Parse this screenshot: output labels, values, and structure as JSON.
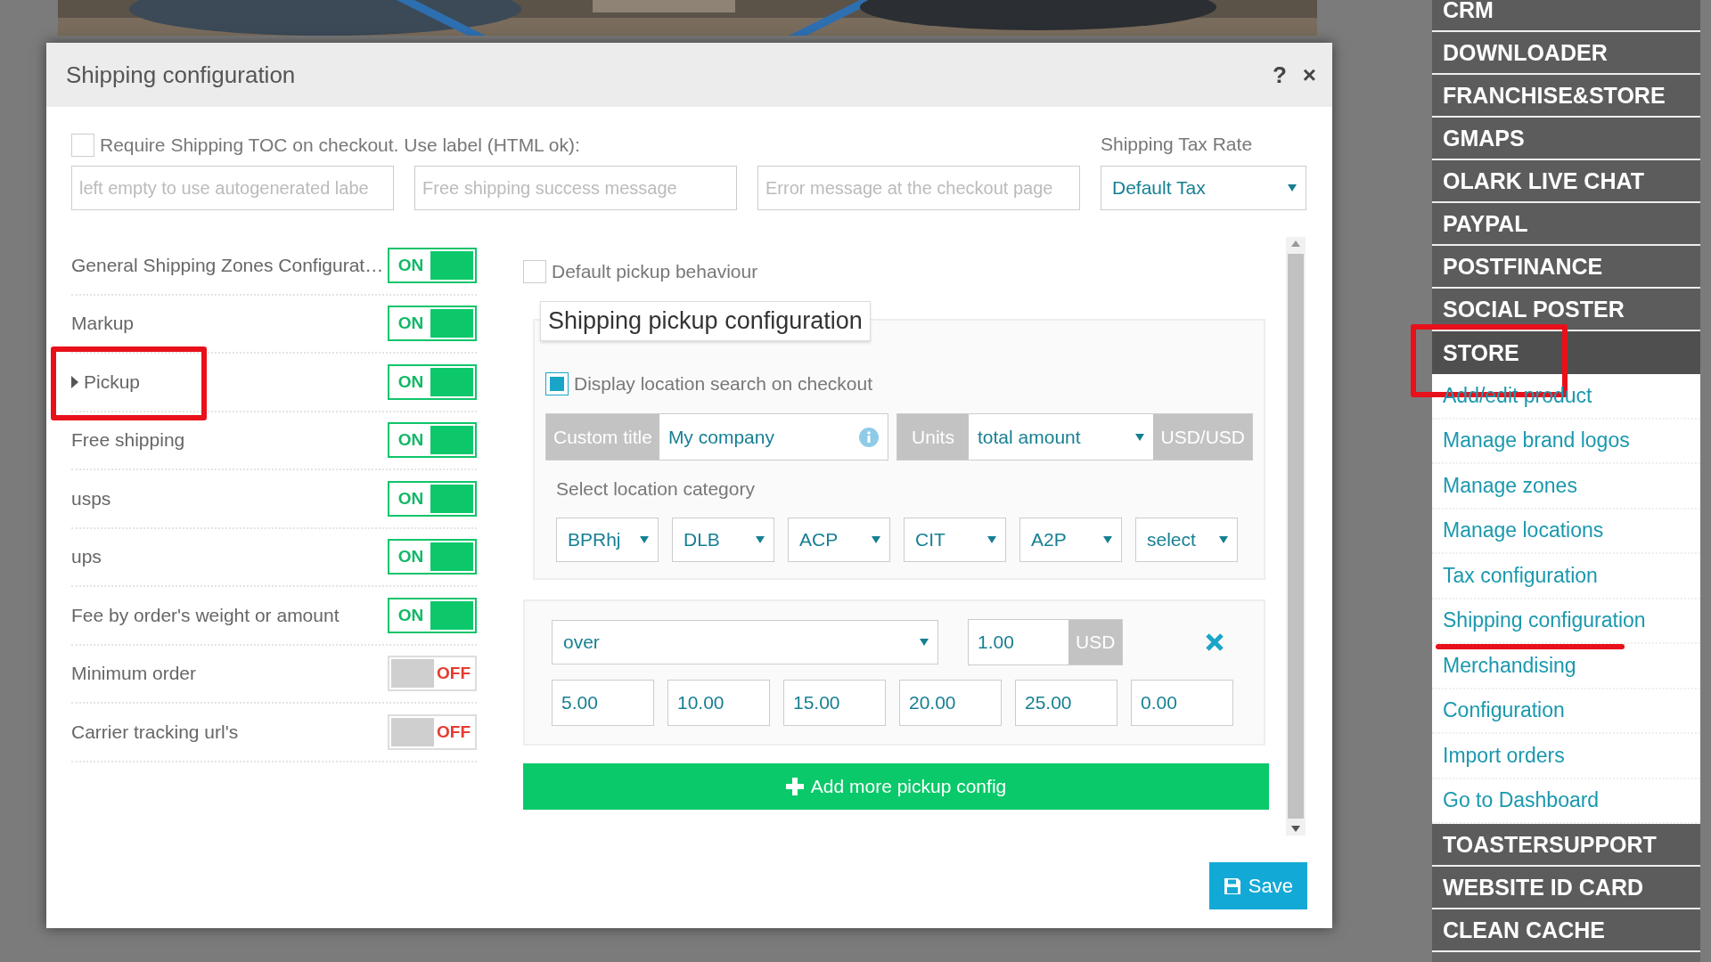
{
  "dialog": {
    "title": "Shipping configuration",
    "help": "?",
    "close": "×"
  },
  "toc": {
    "label": "Require Shipping TOC on checkout. Use label (HTML ok):",
    "checked": false
  },
  "fields": [
    {
      "placeholder": "left empty to use autogenerated labe"
    },
    {
      "placeholder": "Free shipping success message"
    },
    {
      "placeholder": "Error message at the checkout page"
    }
  ],
  "tax_rate": {
    "label": "Shipping Tax Rate",
    "value": "Default Tax"
  },
  "options": [
    {
      "label": "General Shipping Zones Configurat…",
      "on": true,
      "toggle_text": "ON",
      "expandable": false,
      "highlighted": false
    },
    {
      "label": "Markup",
      "on": true,
      "toggle_text": "ON",
      "expandable": false,
      "highlighted": false
    },
    {
      "label": "Pickup",
      "on": true,
      "toggle_text": "ON",
      "expandable": true,
      "highlighted": true
    },
    {
      "label": "Free shipping",
      "on": true,
      "toggle_text": "ON",
      "expandable": false,
      "highlighted": false
    },
    {
      "label": "usps",
      "on": true,
      "toggle_text": "ON",
      "expandable": false,
      "highlighted": false
    },
    {
      "label": "ups",
      "on": true,
      "toggle_text": "ON",
      "expandable": false,
      "highlighted": false
    },
    {
      "label": "Fee by order's weight or amount",
      "on": true,
      "toggle_text": "ON",
      "expandable": false,
      "highlighted": false
    },
    {
      "label": "Minimum order",
      "on": false,
      "toggle_text": "OFF",
      "expandable": false,
      "highlighted": false
    },
    {
      "label": "Carrier tracking url's",
      "on": false,
      "toggle_text": "OFF",
      "expandable": false,
      "highlighted": false
    }
  ],
  "pickup": {
    "default_behaviour": {
      "label": "Default pickup behaviour",
      "checked": false
    },
    "legend": "Shipping pickup configuration",
    "location_search": {
      "label": "Display location search on checkout",
      "checked": true
    },
    "custom_title": {
      "label": "Custom title",
      "value": "My company"
    },
    "units": {
      "label": "Units",
      "value": "total amount",
      "suffix": "USD/USD"
    },
    "category_label": "Select location category",
    "categories": [
      "BPRhj",
      "DLB",
      "ACP",
      "CIT",
      "A2P",
      "select"
    ],
    "rules": [
      {
        "condition": "over",
        "amount": "1.00",
        "currency": "USD",
        "values": [
          "5.00",
          "10.00",
          "15.00",
          "20.00",
          "25.00",
          "0.00"
        ]
      }
    ],
    "add_button": "Add more pickup config"
  },
  "save_button": "Save",
  "sidebar": {
    "items": [
      {
        "label": "CRM",
        "selected": false,
        "highlighted": false
      },
      {
        "label": "DOWNLOADER",
        "selected": false,
        "highlighted": false
      },
      {
        "label": "FRANCHISE&STORE",
        "selected": false,
        "highlighted": false
      },
      {
        "label": "GMAPS",
        "selected": false,
        "highlighted": false
      },
      {
        "label": "OLARK LIVE CHAT",
        "selected": false,
        "highlighted": false
      },
      {
        "label": "PAYPAL",
        "selected": false,
        "highlighted": false
      },
      {
        "label": "POSTFINANCE",
        "selected": false,
        "highlighted": false
      },
      {
        "label": "SOCIAL POSTER",
        "selected": false,
        "highlighted": false
      },
      {
        "label": "STORE",
        "selected": true,
        "highlighted": true,
        "children": [
          {
            "label": "Add/edit product",
            "highlighted": false
          },
          {
            "label": "Manage brand logos",
            "highlighted": false
          },
          {
            "label": "Manage zones",
            "highlighted": false
          },
          {
            "label": "Manage locations",
            "highlighted": false
          },
          {
            "label": "Tax configuration",
            "highlighted": false
          },
          {
            "label": "Shipping configuration",
            "highlighted": true
          },
          {
            "label": "Merchandising",
            "highlighted": false
          },
          {
            "label": "Configuration",
            "highlighted": false
          },
          {
            "label": "Import orders",
            "highlighted": false
          },
          {
            "label": "Go to Dashboard",
            "highlighted": false
          }
        ]
      },
      {
        "label": "TOASTERSUPPORT",
        "selected": false,
        "highlighted": false
      },
      {
        "label": "WEBSITE ID CARD",
        "selected": false,
        "highlighted": false
      },
      {
        "label": "CLEAN CACHE",
        "selected": false,
        "highlighted": false
      }
    ]
  }
}
